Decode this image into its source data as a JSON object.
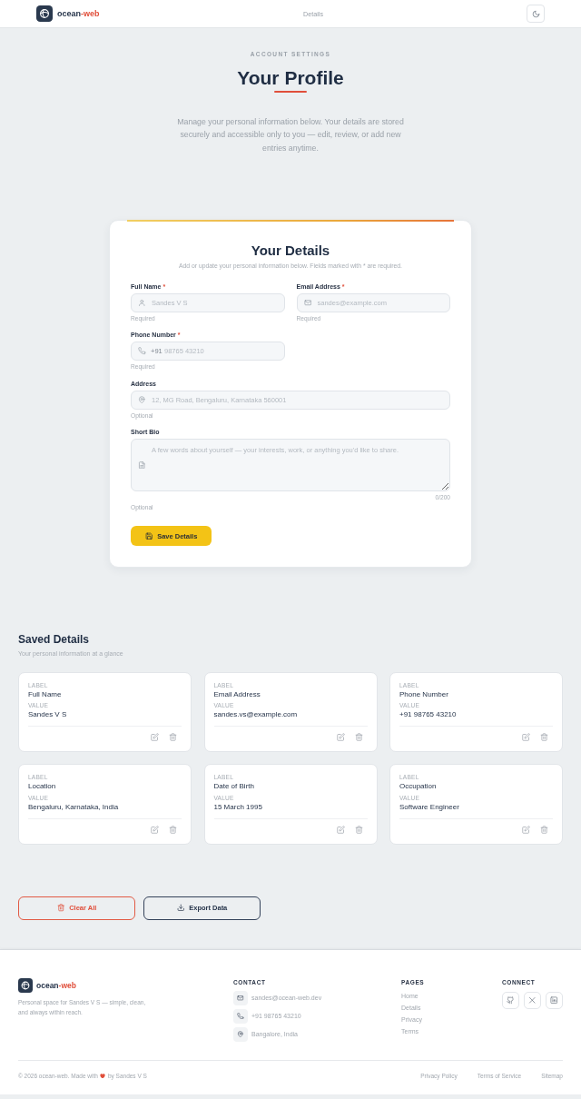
{
  "header": {
    "brand": {
      "name": "ocean",
      "suffix": "-web"
    },
    "nav": [
      "Details"
    ]
  },
  "hero": {
    "eyebrow": "ACCOUNT SETTINGS",
    "title": "Your Profile",
    "description": "Manage your personal information below. Your details are stored securely and accessible only to you — edit, review, or add new entries anytime."
  },
  "form": {
    "title": "Your Details",
    "subtitle": "Add or update your personal information below. Fields marked with * are required.",
    "fields": [
      {
        "kind": "input",
        "label": "Full Name",
        "required_mark": "*",
        "placeholder": "Sandes V S",
        "hint": "Required"
      },
      {
        "kind": "input",
        "label": "Email Address",
        "required_mark": "*",
        "placeholder": "sandes@example.com",
        "hint": "Required"
      },
      {
        "kind": "input",
        "label": "Phone Number",
        "required_mark": "*",
        "prefix": "+91",
        "placeholder": "98765 43210",
        "hint": "Required"
      },
      {
        "kind": "input",
        "label": "Address",
        "placeholder": "12, MG Road, Bengaluru, Karnataka 560001",
        "hint": "Optional"
      },
      {
        "kind": "textarea",
        "label": "Short Bio",
        "placeholder": "A few words about yourself — your interests, work, or anything you'd like to share.",
        "counter": "0/200",
        "hint": "Optional"
      }
    ],
    "submit": "Save Details"
  },
  "saved": {
    "title": "Saved Details",
    "subtitle": "Your personal information at a glance",
    "cards": [
      {
        "label_caption": "LABEL",
        "label": "Full Name",
        "value_caption": "VALUE",
        "value": "Sandes V S"
      },
      {
        "label_caption": "LABEL",
        "label": "Email Address",
        "value_caption": "VALUE",
        "value": "sandes.vs@example.com"
      },
      {
        "label_caption": "LABEL",
        "label": "Phone Number",
        "value_caption": "VALUE",
        "value": "+91 98765 43210"
      },
      {
        "label_caption": "LABEL",
        "label": "Location",
        "value_caption": "VALUE",
        "value": "Bengaluru, Karnataka, India"
      },
      {
        "label_caption": "LABEL",
        "label": "Date of Birth",
        "value_caption": "VALUE",
        "value": "15 March 1995"
      },
      {
        "label_caption": "LABEL",
        "label": "Occupation",
        "value_caption": "VALUE",
        "value": "Software Engineer"
      }
    ]
  },
  "actions": [
    {
      "kind": "danger",
      "label": "Clear All"
    },
    {
      "kind": "outline",
      "label": "Export Data"
    }
  ],
  "footer": {
    "brand": {
      "name": "ocean",
      "suffix": "-web"
    },
    "description": "Personal space for Sandes V S — simple, clean, and always within reach.",
    "contact": {
      "heading": "CONTACT",
      "items": [
        "sandes@ocean-web.dev",
        "+91 98765 43210",
        "Bangalore, India"
      ]
    },
    "pages": {
      "heading": "PAGES",
      "links": [
        "Home",
        "Details",
        "Privacy",
        "Terms"
      ]
    },
    "connect": {
      "heading": "CONNECT"
    },
    "copyright": "© 2026 ocean-web. Made with",
    "author": "by Sandes V S",
    "legal_links": [
      "Privacy Policy",
      "Terms of Service",
      "Sitemap"
    ]
  }
}
